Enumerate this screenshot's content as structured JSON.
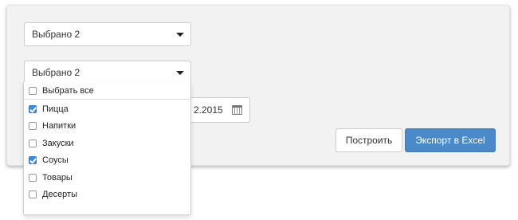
{
  "filters": {
    "select1_value": "Выбрано 2",
    "select2_value": "Выбрано 2",
    "date_value": "2.2015"
  },
  "dropdown": {
    "select_all_label": "Выбрать все",
    "select_all_checked": false,
    "items": [
      {
        "label": "Пицца",
        "checked": true
      },
      {
        "label": "Напитки",
        "checked": false
      },
      {
        "label": "Закуски",
        "checked": false
      },
      {
        "label": "Соусы",
        "checked": true
      },
      {
        "label": "Товары",
        "checked": false
      },
      {
        "label": "Десерты",
        "checked": false
      }
    ]
  },
  "buttons": {
    "build_label": "Построить",
    "export_label": "Экспорт в Excel"
  },
  "colors": {
    "accent": "#4a8ac9",
    "checkbox_checked": "#3f8be0",
    "panel_bg": "#f2f2f2"
  },
  "icons": {
    "caret": "chevron-down-icon",
    "calendar": "calendar-icon",
    "check": "checkmark-icon"
  }
}
